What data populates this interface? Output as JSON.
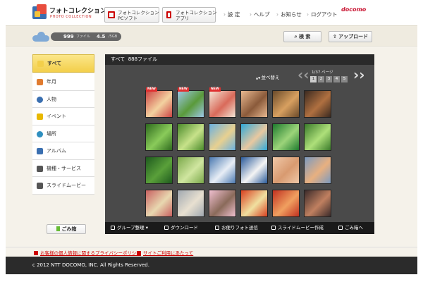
{
  "header": {
    "logo_jp": "フォトコレクション",
    "logo_en": "PHOTO COLLECTION",
    "pc_button": [
      "フォトコレクション",
      "PCソフト"
    ],
    "app_button": [
      "フォトコレクション",
      "アプリ"
    ],
    "links": [
      "設 定",
      "ヘルプ",
      "お知らせ",
      "ログアウト"
    ],
    "docomo": "docomo"
  },
  "status": {
    "file_count": "999",
    "file_unit": "ファイル",
    "capacity": "4.5",
    "capacity_unit": "/5GB",
    "search_label": "検 索",
    "upload_label": "アップロード"
  },
  "sidebar": {
    "items": [
      {
        "label": "すべて",
        "icon": "grid-icon",
        "color": "#f3cf4a"
      },
      {
        "label": "年月",
        "icon": "calendar-icon",
        "color": "#e07b2f"
      },
      {
        "label": "人物",
        "icon": "person-icon",
        "color": "#3a6fb0"
      },
      {
        "label": "イベント",
        "icon": "star-icon",
        "color": "#e8b800"
      },
      {
        "label": "場所",
        "icon": "globe-icon",
        "color": "#2f8fbf"
      },
      {
        "label": "アルバム",
        "icon": "album-icon",
        "color": "#3a6fb0"
      },
      {
        "label": "機種・サービス",
        "icon": "phone-icon",
        "color": "#555555"
      },
      {
        "label": "スライドムービー",
        "icon": "film-icon",
        "color": "#555555"
      }
    ],
    "trash_label": "ごみ箱"
  },
  "panel": {
    "title": "すべて",
    "count": "888ファイル",
    "sort_label": "並べ替え",
    "page_info": "1/37 ページ",
    "pages": [
      "1",
      "2",
      "3",
      "4",
      "5"
    ],
    "new_badge": "NEW",
    "thumbnails": [
      {
        "c1": "#c44",
        "c2": "#f3d2a0",
        "new": true
      },
      {
        "c1": "#9dc7e8",
        "c2": "#5a9a3a",
        "new": true
      },
      {
        "c1": "#f4e6d6",
        "c2": "#d96a5a",
        "new": true
      },
      {
        "c1": "#e8b890",
        "c2": "#8a5a3a",
        "new": false
      },
      {
        "c1": "#6a4a2a",
        "c2": "#d8a060",
        "new": false
      },
      {
        "c1": "#3a2a20",
        "c2": "#b07040",
        "new": false
      },
      {
        "c1": "#2e6a1e",
        "c2": "#8acb5a",
        "new": false
      },
      {
        "c1": "#4a8a2a",
        "c2": "#c7e28a",
        "new": false
      },
      {
        "c1": "#6ab0e0",
        "c2": "#e8d090",
        "new": false
      },
      {
        "c1": "#2fa8d8",
        "c2": "#e8c8a0",
        "new": false
      },
      {
        "c1": "#1e7a2e",
        "c2": "#9cd47a",
        "new": false
      },
      {
        "c1": "#3a7a2a",
        "c2": "#aee07a",
        "new": false
      },
      {
        "c1": "#1e5a1e",
        "c2": "#5aa03a",
        "new": false
      },
      {
        "c1": "#7aa84a",
        "c2": "#d0e6a0",
        "new": false
      },
      {
        "c1": "#4a78b0",
        "c2": "#e8eef6",
        "new": false
      },
      {
        "c1": "#2a5a9a",
        "c2": "#f4f4f4",
        "new": false
      },
      {
        "c1": "#f0c8a8",
        "c2": "#d89a70",
        "new": false
      },
      {
        "c1": "#7a9ac0",
        "c2": "#e8b080",
        "new": false
      },
      {
        "c1": "#c86060",
        "c2": "#e8d8b0",
        "new": false
      },
      {
        "c1": "#a0a8b0",
        "c2": "#e8e0d0",
        "new": false
      },
      {
        "c1": "#f0c0d0",
        "c2": "#8a6a5a",
        "new": false
      },
      {
        "c1": "#d84020",
        "c2": "#f0e0a0",
        "new": false
      },
      {
        "c1": "#c03020",
        "c2": "#f0a060",
        "new": false
      },
      {
        "c1": "#3a2a2a",
        "c2": "#c08060",
        "new": false
      }
    ]
  },
  "toolbar": {
    "group": "グループ整理",
    "download": "ダウンロード",
    "send": "お便りフォト送信",
    "slide": "スライドムービー作成",
    "trash": "ごみ箱へ"
  },
  "footer": {
    "privacy": "お客様の個人情報に関するプライバシーポリシー",
    "terms": "サイトご利用にあたって",
    "copyright": "c 2012 NTT DOCOMO, INC. All Rights Reserved."
  }
}
